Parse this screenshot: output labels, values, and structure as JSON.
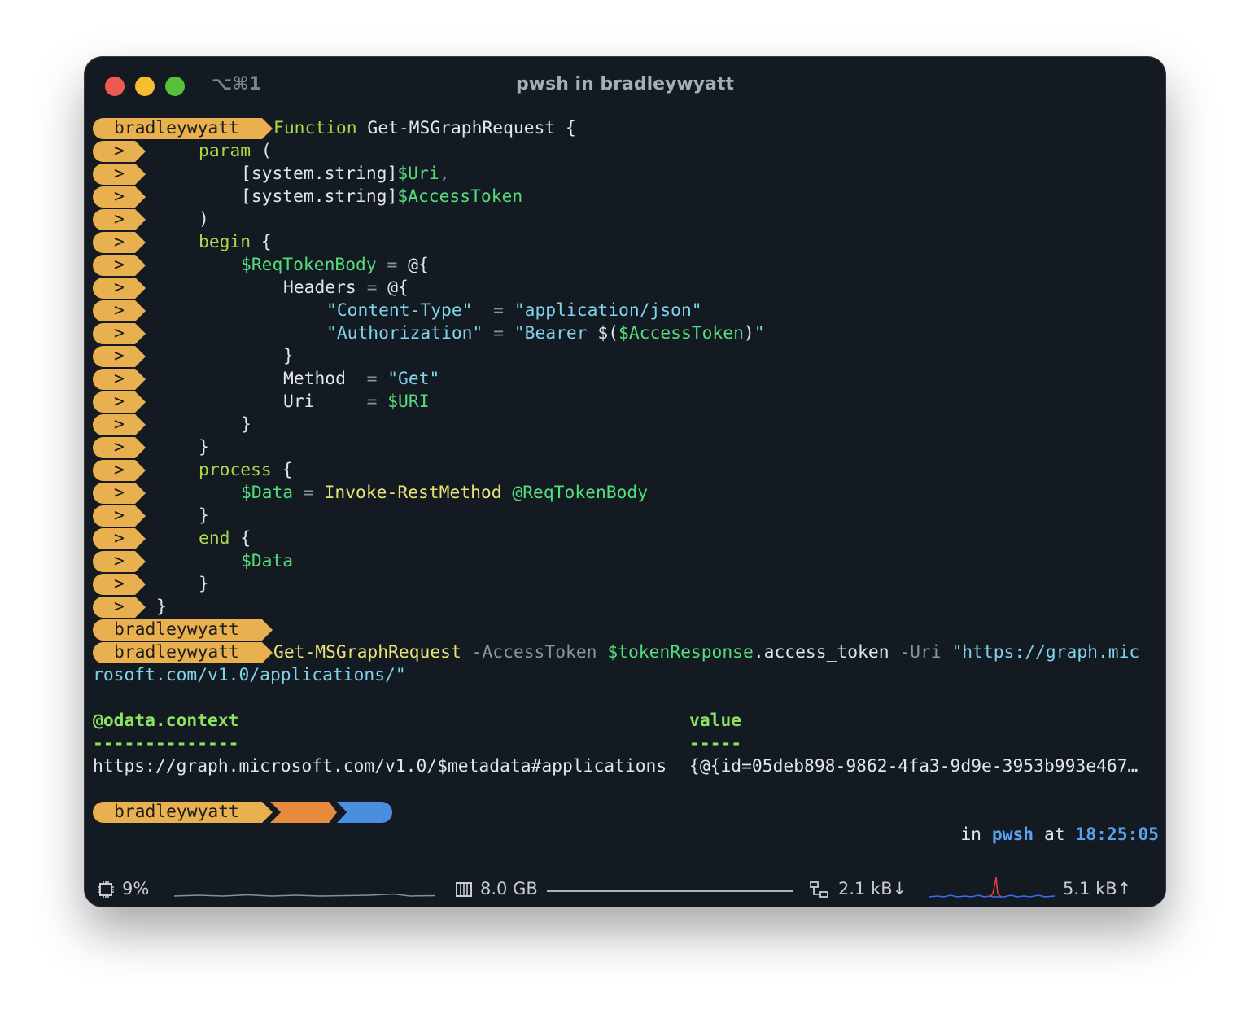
{
  "window": {
    "shortcut": "⌥⌘1",
    "title": "pwsh in bradleywyatt"
  },
  "prompt": {
    "user": "bradleywyatt",
    "continuation": ">",
    "folder": "~",
    "status_check": "✓",
    "right_in": "in",
    "right_shell": "pwsh",
    "right_at": "at",
    "right_time": "18:25:05"
  },
  "colors": {
    "user_pill": "#e8b04e",
    "folder_pill": "#e68a3e",
    "status_pill": "#4a8fdf",
    "background": "#131a22"
  },
  "code": {
    "l0_kw": "Function",
    "l0_name": " Get-MSGraphRequest {",
    "l1_kw": "param",
    "l1_rest": " (",
    "l2_type": "[system.string]",
    "l2_var": "$Uri",
    "l2_comma": ",",
    "l3_type": "[system.string]",
    "l3_var": "$AccessToken",
    "l4": ")",
    "l5_kw": "begin",
    "l5_rest": " {",
    "l6_var": "$ReqTokenBody",
    "l6_op": " = ",
    "l6_rest": "@{",
    "l7_key": "Headers",
    "l7_op": " = ",
    "l7_rest": "@{",
    "l8_str": "\"Content-Type\"",
    "l8_op": "  = ",
    "l8_val": "\"application/json\"",
    "l9_str": "\"Authorization\"",
    "l9_op": " = ",
    "l9_val1": "\"Bearer ",
    "l9_sub": "$(",
    "l9_var": "$AccessToken",
    "l9_sub2": ")",
    "l9_val2": "\"",
    "l10": "}",
    "l11_key": "Method",
    "l11_op": "  = ",
    "l11_val": "\"Get\"",
    "l12_key": "Uri",
    "l12_op": "     = ",
    "l12_val": "$URI",
    "l13": "}",
    "l14": "}",
    "l15_kw": "process",
    "l15_rest": " {",
    "l16_var": "$Data",
    "l16_op": " = ",
    "l16_fn": "Invoke-RestMethod",
    "l16_splat": " @ReqTokenBody",
    "l17": "}",
    "l18_kw": "end",
    "l18_rest": " {",
    "l19_var": "$Data",
    "l20": "}",
    "l21": "}"
  },
  "command": {
    "name": "Get-MSGraphRequest",
    "param1": " -AccessToken ",
    "var": "$tokenResponse",
    "member": ".access_token",
    "param2": " -Uri ",
    "url_part1": "\"https://graph.mic",
    "url_part2": "rosoft.com/v1.0/applications/\""
  },
  "output": {
    "headers": [
      "@odata.context",
      "value"
    ],
    "separators": [
      "--------------",
      "-----"
    ],
    "row": [
      "https://graph.microsoft.com/v1.0/$metadata#applications",
      "{@{id=05deb898-9862-4fa3-9d9e-3953b993e467…"
    ]
  },
  "statusbar": {
    "cpu": "9%",
    "memory": "8.0 GB",
    "net_down": "2.1 kB↓",
    "net_up": "5.1 kB↑"
  }
}
